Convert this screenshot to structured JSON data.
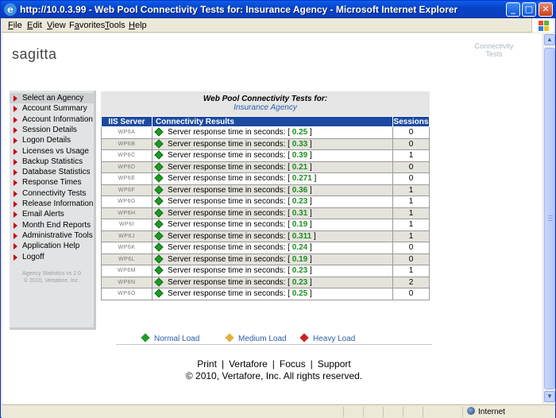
{
  "window": {
    "title": "http://10.0.3.99 - Web Pool Connectivity Tests for: Insurance Agency - Microsoft Internet Explorer",
    "minimize": "_",
    "maximize": "□",
    "close": "✕"
  },
  "menu": [
    {
      "label": "File",
      "key": "F"
    },
    {
      "label": "Edit",
      "key": "E"
    },
    {
      "label": "View",
      "key": "V"
    },
    {
      "label": "Favorites",
      "key": "a"
    },
    {
      "label": "Tools",
      "key": "T"
    },
    {
      "label": "Help",
      "key": "H"
    }
  ],
  "logo": "sagitta",
  "corner_label": "Connectivity Tests",
  "sidebar": {
    "items": [
      "Select an Agency",
      "Account Summary",
      "Account Information",
      "Session Details",
      "Logon Details",
      "Licenses vs Usage",
      "Backup Statistics",
      "Database Statistics",
      "Response Times",
      "Connectivity Tests",
      "Release Information",
      "Email Alerts",
      "Month End Reports",
      "Administrative Tools",
      "Application Help",
      "Logoff"
    ],
    "footer_line1": "Agency Statistics vs 2.0",
    "footer_line2": "© 2010, Vertafore, Inc."
  },
  "main": {
    "heading": "Web Pool Connectivity Tests for:",
    "agency": "Insurance Agency",
    "columns": [
      "IIS Server",
      "Connectivity Results",
      "Sessions"
    ],
    "result_prefix": "Server response time in seconds: [ ",
    "result_suffix": " ]",
    "rows": [
      {
        "server": "WP6A",
        "time": "0.25",
        "sessions": "0"
      },
      {
        "server": "WP6B",
        "time": "0.33",
        "sessions": "0"
      },
      {
        "server": "WP6C",
        "time": "0.39",
        "sessions": "1"
      },
      {
        "server": "WP6D",
        "time": "0.21",
        "sessions": "0"
      },
      {
        "server": "WP6E",
        "time": "0.271",
        "sessions": "0"
      },
      {
        "server": "WP6F",
        "time": "0.36",
        "sessions": "1"
      },
      {
        "server": "WP6G",
        "time": "0.23",
        "sessions": "1"
      },
      {
        "server": "WP6H",
        "time": "0.31",
        "sessions": "1"
      },
      {
        "server": "WP6I",
        "time": "0.19",
        "sessions": "1"
      },
      {
        "server": "WP6J",
        "time": "0.311",
        "sessions": "1"
      },
      {
        "server": "WP6K",
        "time": "0.24",
        "sessions": "0"
      },
      {
        "server": "WP6L",
        "time": "0.19",
        "sessions": "0"
      },
      {
        "server": "WP6M",
        "time": "0.23",
        "sessions": "1"
      },
      {
        "server": "WP6N",
        "time": "0.23",
        "sessions": "2"
      },
      {
        "server": "WP6O",
        "time": "0.25",
        "sessions": "0"
      }
    ]
  },
  "legend": {
    "normal": "Normal Load",
    "medium": "Medium Load",
    "heavy": "Heavy Load",
    "colors": {
      "normal": "#1d9b25",
      "medium": "#e0b040",
      "heavy": "#cc2222"
    }
  },
  "footer": {
    "links": [
      "Print",
      "Vertafore",
      "Focus",
      "Support"
    ],
    "separator": "|",
    "copyright": "© 2010,  Vertafore, Inc. All rights reserved."
  },
  "status": {
    "zone": "Internet"
  }
}
